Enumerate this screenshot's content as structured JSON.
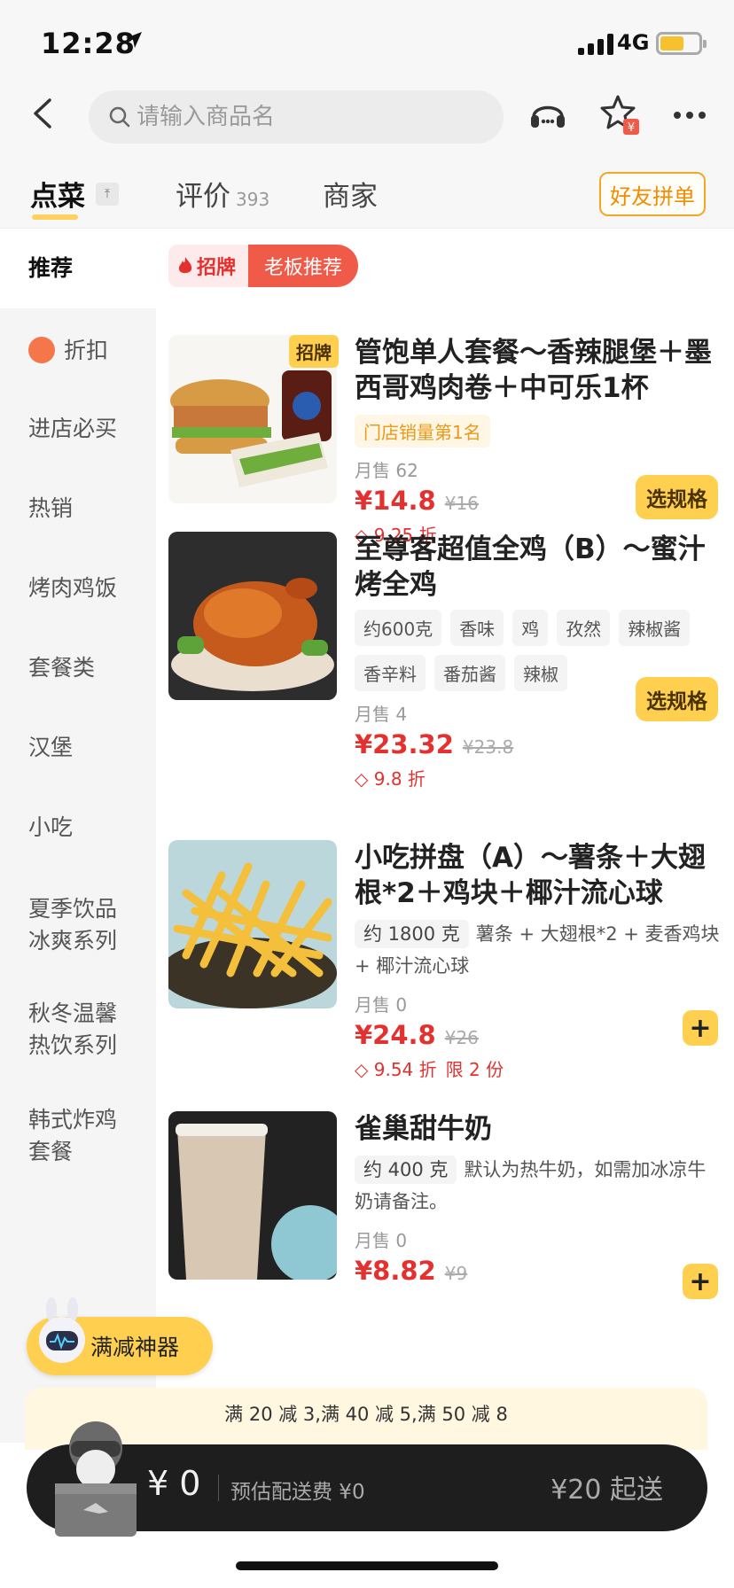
{
  "status_bar": {
    "time": "12:28",
    "network": "4G"
  },
  "header": {
    "search_placeholder": "请输入商品名"
  },
  "tabs": {
    "order": "点菜",
    "reviews": "评价",
    "reviews_count": "393",
    "merchant": "商家",
    "group_button": "好友拼单"
  },
  "sidebar": {
    "items": [
      {
        "label": "推荐"
      },
      {
        "label": "折扣"
      },
      {
        "label": "进店必买"
      },
      {
        "label": "热销"
      },
      {
        "label": "烤肉鸡饭"
      },
      {
        "label": "套餐类"
      },
      {
        "label": "汉堡"
      },
      {
        "label": "小吃"
      },
      {
        "label": "夏季饮品冰爽系列"
      },
      {
        "label": "秋冬温馨热饮系列"
      },
      {
        "label": "韩式炸鸡套餐"
      }
    ]
  },
  "recommend_bar": {
    "sign": "招牌",
    "boss": "老板推荐"
  },
  "products": [
    {
      "badge": "招牌",
      "name": "管饱单人套餐～香辣腿堡＋墨西哥鸡肉卷＋中可乐1杯",
      "rank": "门店销量第1名",
      "sales": "月售 62",
      "price": "¥14.8",
      "old_price": "¥16",
      "discount": "9.25 折",
      "action": "选规格"
    },
    {
      "name": "至尊客超值全鸡（B）～蜜汁烤全鸡",
      "tags": [
        "约600克",
        "香味",
        "鸡",
        "孜然",
        "辣椒酱",
        "香辛料",
        "番茄酱",
        "辣椒"
      ],
      "sales": "月售 4",
      "price": "¥23.32",
      "old_price": "¥23.8",
      "discount": "9.8 折",
      "action": "选规格"
    },
    {
      "name": "小吃拼盘（A）～薯条＋大翅根*2＋鸡块＋椰汁流心球",
      "weight": "约 1800 克",
      "desc": "薯条 + 大翅根*2 + 麦香鸡块 + 椰汁流心球",
      "sales": "月售 0",
      "price": "¥24.8",
      "old_price": "¥26",
      "discount": "9.54 折",
      "limit": "限 2 份",
      "action": "+"
    },
    {
      "name": "雀巢甜牛奶",
      "weight": "约 400 克",
      "desc": "默认为热牛奶，如需加冰凉牛奶请备注。",
      "sales": "月售 0",
      "price": "¥8.82",
      "old_price": "¥9",
      "action": "+"
    }
  ],
  "promo_float": "满减神器",
  "promo_banner": "满 20 减 3,满 40 减 5,满 50 减 8",
  "cart": {
    "total": "¥ 0",
    "delivery_fee": "预估配送费 ¥0",
    "min_order": "¥20 起送"
  },
  "colors": {
    "accent": "#ffd050",
    "price_red": "#e4312f",
    "cart_bg": "#1e1e1e"
  }
}
